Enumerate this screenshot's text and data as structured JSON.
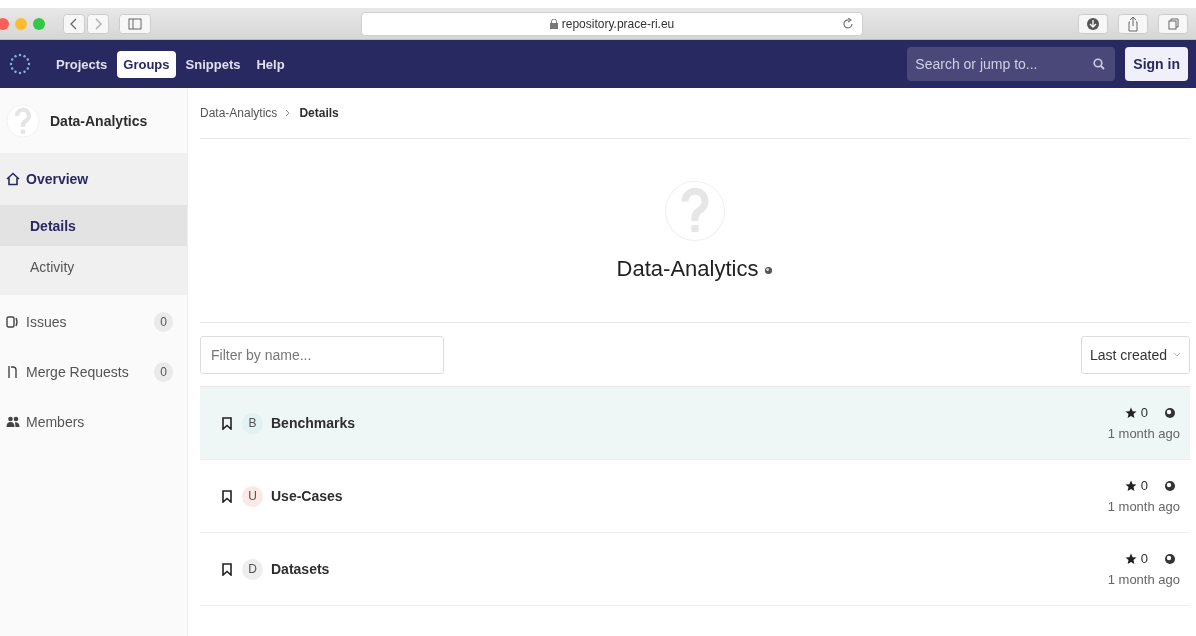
{
  "browser": {
    "address": "repository.prace-ri.eu"
  },
  "navbar": {
    "items": [
      {
        "label": "Projects",
        "selected": false
      },
      {
        "label": "Groups",
        "selected": true
      },
      {
        "label": "Snippets",
        "selected": false
      },
      {
        "label": "Help",
        "selected": false
      }
    ],
    "search": {
      "placeholder": "Search or jump to..."
    },
    "sign_in": "Sign in"
  },
  "sidebar": {
    "group_name": "Data-Analytics",
    "items": [
      {
        "label": "Overview",
        "selected": true,
        "children": [
          {
            "label": "Details",
            "selected": true
          },
          {
            "label": "Activity",
            "selected": false
          }
        ]
      },
      {
        "label": "Issues",
        "count": "0",
        "selected": false
      },
      {
        "label": "Merge Requests",
        "count": "0",
        "selected": false
      },
      {
        "label": "Members",
        "selected": false
      }
    ]
  },
  "breadcrumb": [
    "Data-Analytics",
    "Details"
  ],
  "group": {
    "title": "Data-Analytics"
  },
  "filter": {
    "placeholder": "Filter by name..."
  },
  "sort": {
    "value": "Last created"
  },
  "projects": [
    {
      "initial": "B",
      "name": "Benchmarks",
      "color": "#e0f2f1",
      "hovered": true,
      "stars": "0",
      "updated": "1 month ago"
    },
    {
      "initial": "U",
      "name": "Use-Cases",
      "color": "#fbe9e7",
      "hovered": false,
      "stars": "0",
      "updated": "1 month ago"
    },
    {
      "initial": "D",
      "name": "Datasets",
      "color": "#eeeeee",
      "hovered": false,
      "stars": "0",
      "updated": "1 month ago"
    }
  ]
}
